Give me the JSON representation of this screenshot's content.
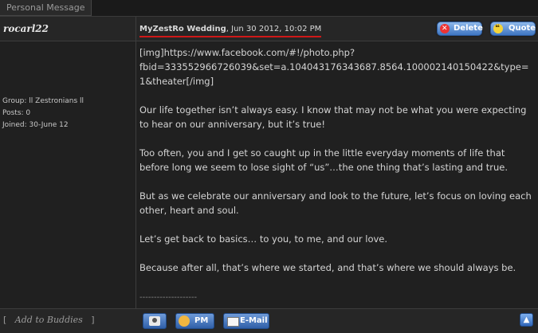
{
  "tab": {
    "label": "Personal Message"
  },
  "author": {
    "name": "rocarl22",
    "group": "Group: ll Zestronians ll",
    "posts": "Posts: 0",
    "joined": "Joined: 30-June 12"
  },
  "post": {
    "title": "MyZestRo Wedding",
    "date": ", Jun 30 2012, 10:02 PM",
    "img_line1": "[img]https://www.facebook.com/#!/photo.php?",
    "img_line2": "fbid=333552966726039&set=a.104043176343687.8564.100002140150422&type=1&theater[/img]",
    "paragraphs": [
      "Our life together isn’t always easy. I know that may not be what you were expecting to hear on our anniversary, but it’s true!",
      "Too often, you and I get so caught up in the little everyday moments of life that before long we seem to lose sight of “us”…the one thing that’s lasting and true.",
      "But as we celebrate our anniversary and look to the future, let’s focus on loving each other, heart and soul.",
      "Let’s get back to basics… to you, to me, and our love.",
      "Because after all, that’s where we started, and that’s where we should always be."
    ],
    "signature_separator": "--------------------"
  },
  "actions": {
    "delete": "Delete",
    "quote": "Quote"
  },
  "footer": {
    "bracket_open": "[",
    "add_buddies": "Add to Buddies",
    "bracket_close": "]",
    "pm": "PM",
    "email": "E-Mail",
    "top_arrow": "▲"
  }
}
